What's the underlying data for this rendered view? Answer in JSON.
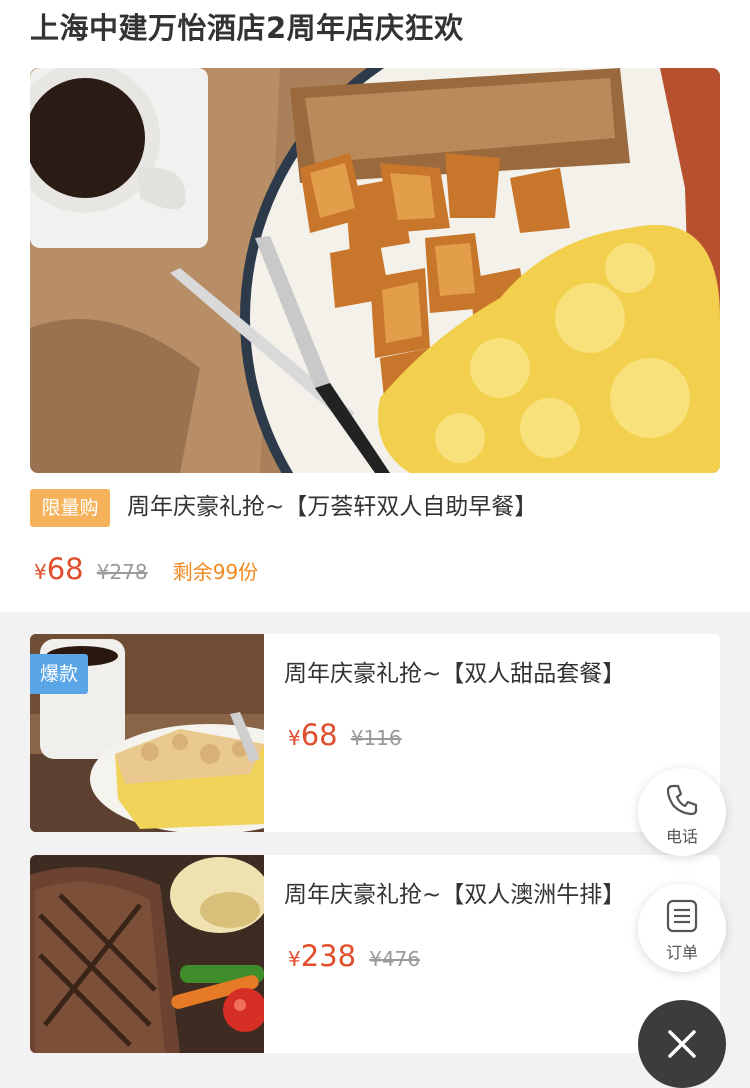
{
  "page": {
    "title": "上海中建万怡酒店2周年店庆狂欢"
  },
  "featured": {
    "tag": "限量购",
    "title": "周年庆豪礼抢~【万荟轩双人自助早餐】",
    "currency": "¥",
    "price": "68",
    "original_price": "¥278",
    "stock": "剩余99份"
  },
  "items": [
    {
      "badge": "爆款",
      "title": "周年庆豪礼抢~【双人甜品套餐】",
      "currency": "¥",
      "price": "68",
      "original_price": "¥116"
    },
    {
      "title": "周年庆豪礼抢~【双人澳洲牛排】",
      "currency": "¥",
      "price": "238",
      "original_price": "¥476"
    }
  ],
  "float_buttons": {
    "phone_label": "电话",
    "order_label": "订单"
  },
  "colors": {
    "price": "#e04e2b",
    "stock": "#f08a1f",
    "limited_tag": "#f5b25a",
    "hot_badge": "#5aa5e6"
  },
  "icons": [
    "phone-icon",
    "order-list-icon",
    "close-icon"
  ]
}
